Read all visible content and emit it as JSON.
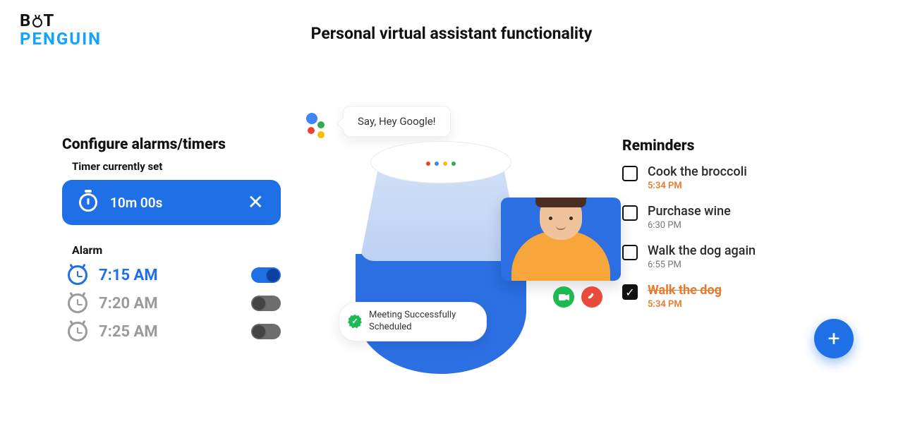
{
  "brand": {
    "line1": "B",
    "line1b": "T",
    "line2": "PENGUIN"
  },
  "page_title": "Personal virtual assistant functionality",
  "left": {
    "heading": "Configure alarms/timers",
    "timer_label": "Timer currently set",
    "timer_value": "10m 00s",
    "alarm_label": "Alarm",
    "alarms": [
      {
        "time": "7:15 AM",
        "on": true
      },
      {
        "time": "7:20 AM",
        "on": false
      },
      {
        "time": "7:25 AM",
        "on": false
      }
    ]
  },
  "center": {
    "say_bubble": "Say, Hey Google!",
    "meeting_text": "Meeting Successfully Scheduled"
  },
  "right": {
    "heading": "Reminders",
    "items": [
      {
        "title": "Cook the broccoli",
        "time": "5:34 PM",
        "done": false,
        "time_orange": true
      },
      {
        "title": "Purchase wine",
        "time": "6:30 PM",
        "done": false,
        "time_orange": false
      },
      {
        "title": "Walk the dog again",
        "time": "6:55 PM",
        "done": false,
        "time_orange": false
      },
      {
        "title": "Walk the dog",
        "time": "5:34 PM",
        "done": true,
        "time_orange": true
      }
    ]
  }
}
